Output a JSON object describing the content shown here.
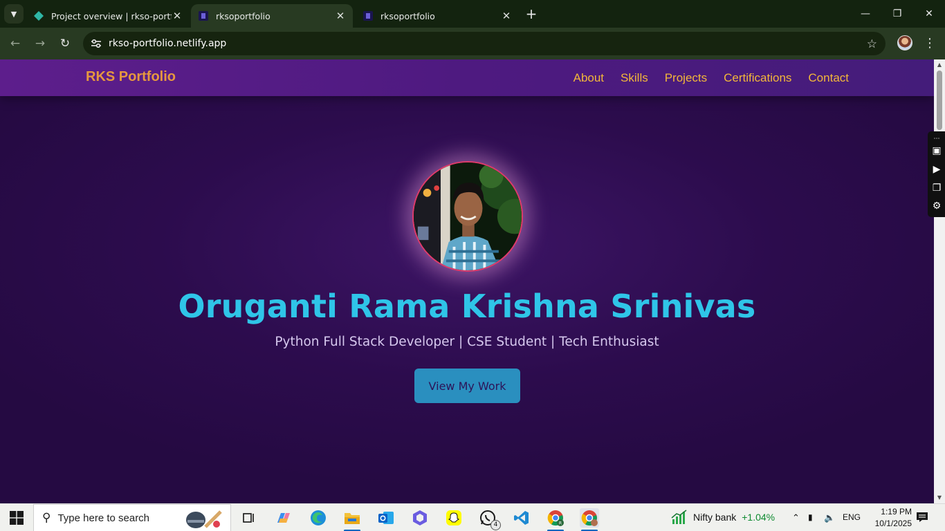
{
  "browser": {
    "tabs": [
      {
        "title": "Project overview | rkso-portfolio",
        "active": false,
        "favicon": "netlify-diamond-icon"
      },
      {
        "title": "rksoportfolio",
        "active": true,
        "favicon": "site-favicon-icon"
      },
      {
        "title": "rksoportfolio",
        "active": false,
        "favicon": "site-favicon-icon"
      }
    ],
    "url": "rkso-portfolio.netlify.app"
  },
  "site": {
    "brand": "RKS Portfolio",
    "nav": [
      "About",
      "Skills",
      "Projects",
      "Certifications",
      "Contact"
    ],
    "hero": {
      "name": "Oruganti Rama Krishna Srinivas",
      "subtitle": "Python Full Stack Developer | CSE Student | Tech Enthusiast",
      "cta": "View My Work"
    },
    "colors": {
      "brand": "#e6983f",
      "nav_link": "#f3b73a",
      "name": "#2fc5e8",
      "cta_bg": "#2a8fbf",
      "background": "#2c0c4d"
    }
  },
  "taskbar": {
    "search_placeholder": "Type here to search",
    "whatsapp_badge": "4",
    "widget": {
      "name": "Nifty bank",
      "change": "+1.04%"
    },
    "lang": "ENG",
    "time": "1:19 PM",
    "date": "10/1/2025"
  }
}
